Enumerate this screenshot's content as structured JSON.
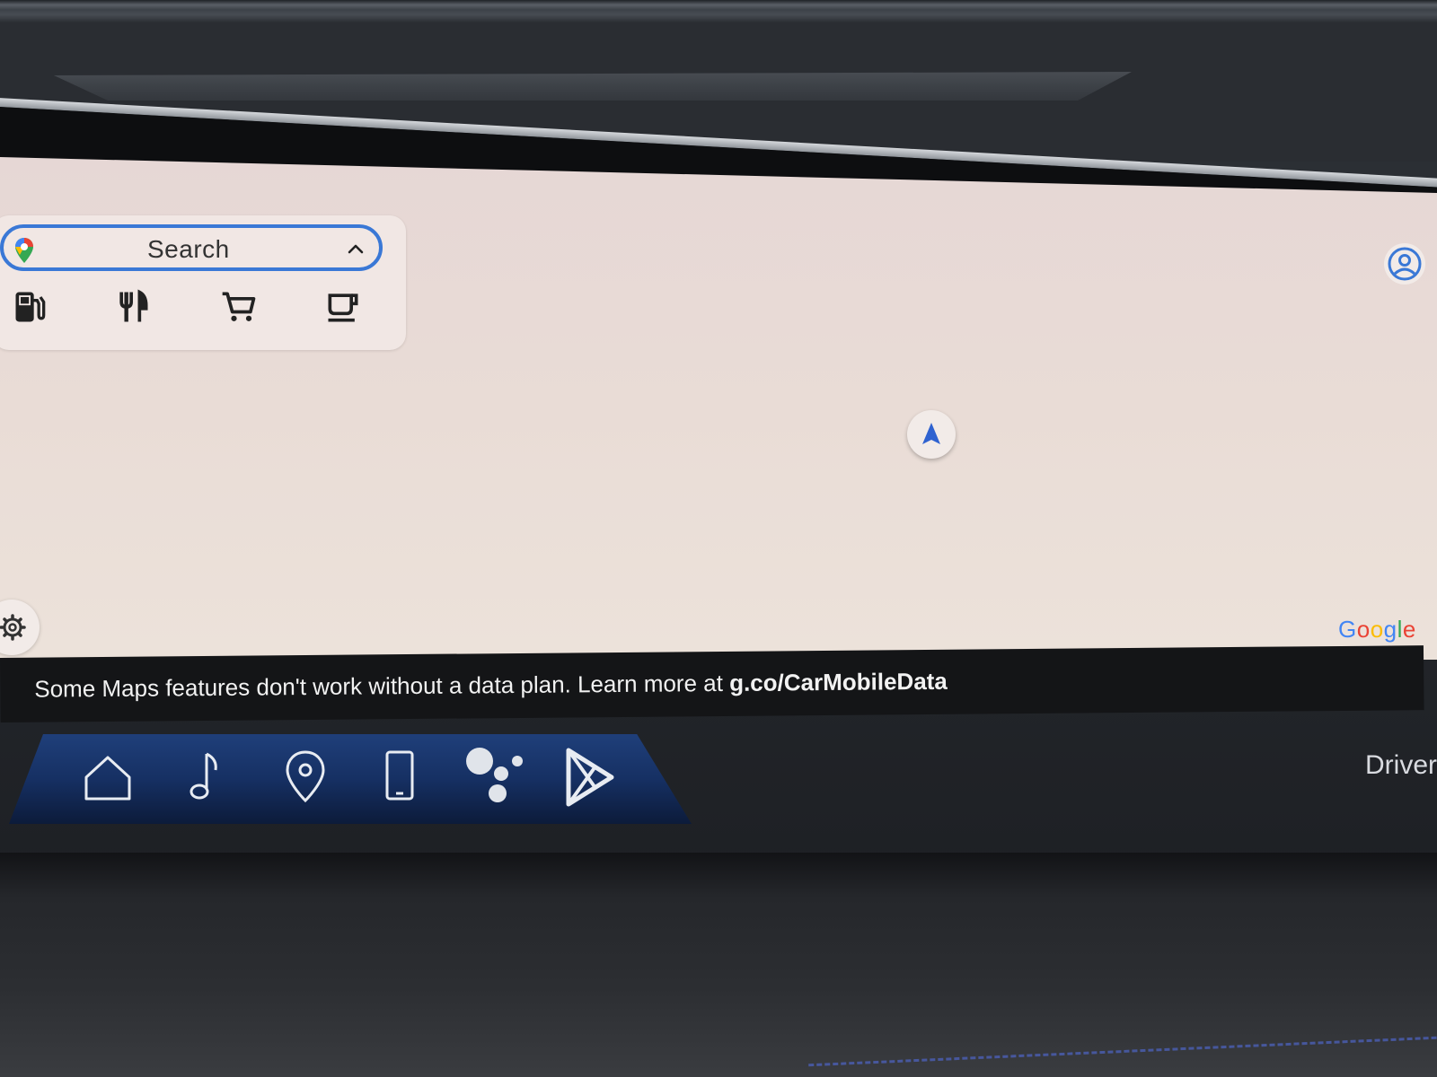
{
  "search": {
    "label": "Search"
  },
  "poi_shortcuts": [
    {
      "icon": "gas-station-icon"
    },
    {
      "icon": "restaurant-icon"
    },
    {
      "icon": "shopping-cart-icon"
    },
    {
      "icon": "coffee-icon"
    }
  ],
  "map": {
    "attribution": "Google"
  },
  "notice": {
    "text": "Some Maps features don't work without a data plan. Learn more at ",
    "link": "g.co/CarMobileData"
  },
  "dock": {
    "items": [
      {
        "icon": "home-icon"
      },
      {
        "icon": "music-note-icon"
      },
      {
        "icon": "map-pin-icon"
      },
      {
        "icon": "phone-icon"
      },
      {
        "icon": "assistant-icon"
      },
      {
        "icon": "play-store-icon"
      }
    ]
  },
  "status": {
    "driver_label": "Driver"
  },
  "colors": {
    "accent": "#3a78d6",
    "map_bg": "#e9dcd6",
    "dock": "#163063",
    "notice_bg": "#141517"
  }
}
